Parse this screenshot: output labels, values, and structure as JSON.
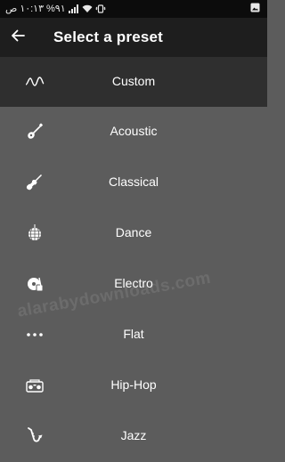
{
  "status_bar": {
    "time": "١٠:١٣",
    "ampm": "ص",
    "battery": "%٩١",
    "icons": [
      "signal-icon",
      "wifi-icon",
      "vibrate-icon",
      "gallery-icon"
    ]
  },
  "header": {
    "title": "Select a preset",
    "back_icon": "arrow-back-icon"
  },
  "presets": [
    {
      "label": "Custom",
      "icon": "custom-wave-icon",
      "selected": true
    },
    {
      "label": "Acoustic",
      "icon": "acoustic-guitar-icon",
      "selected": false
    },
    {
      "label": "Classical",
      "icon": "violin-icon",
      "selected": false
    },
    {
      "label": "Dance",
      "icon": "disco-ball-icon",
      "selected": false
    },
    {
      "label": "Electro",
      "icon": "turntable-icon",
      "selected": false
    },
    {
      "label": "Flat",
      "icon": "dots-icon",
      "selected": false
    },
    {
      "label": "Hip-Hop",
      "icon": "boombox-icon",
      "selected": false
    },
    {
      "label": "Jazz",
      "icon": "saxophone-icon",
      "selected": false
    }
  ],
  "watermark": "alarabydownloads.com",
  "colors": {
    "status_bar_bg": "#0c0c0c",
    "app_bar_bg": "#1e1e1e",
    "selected_bg": "#2f2f2f",
    "list_bg": "#5c5c5c",
    "text": "#ffffff"
  }
}
